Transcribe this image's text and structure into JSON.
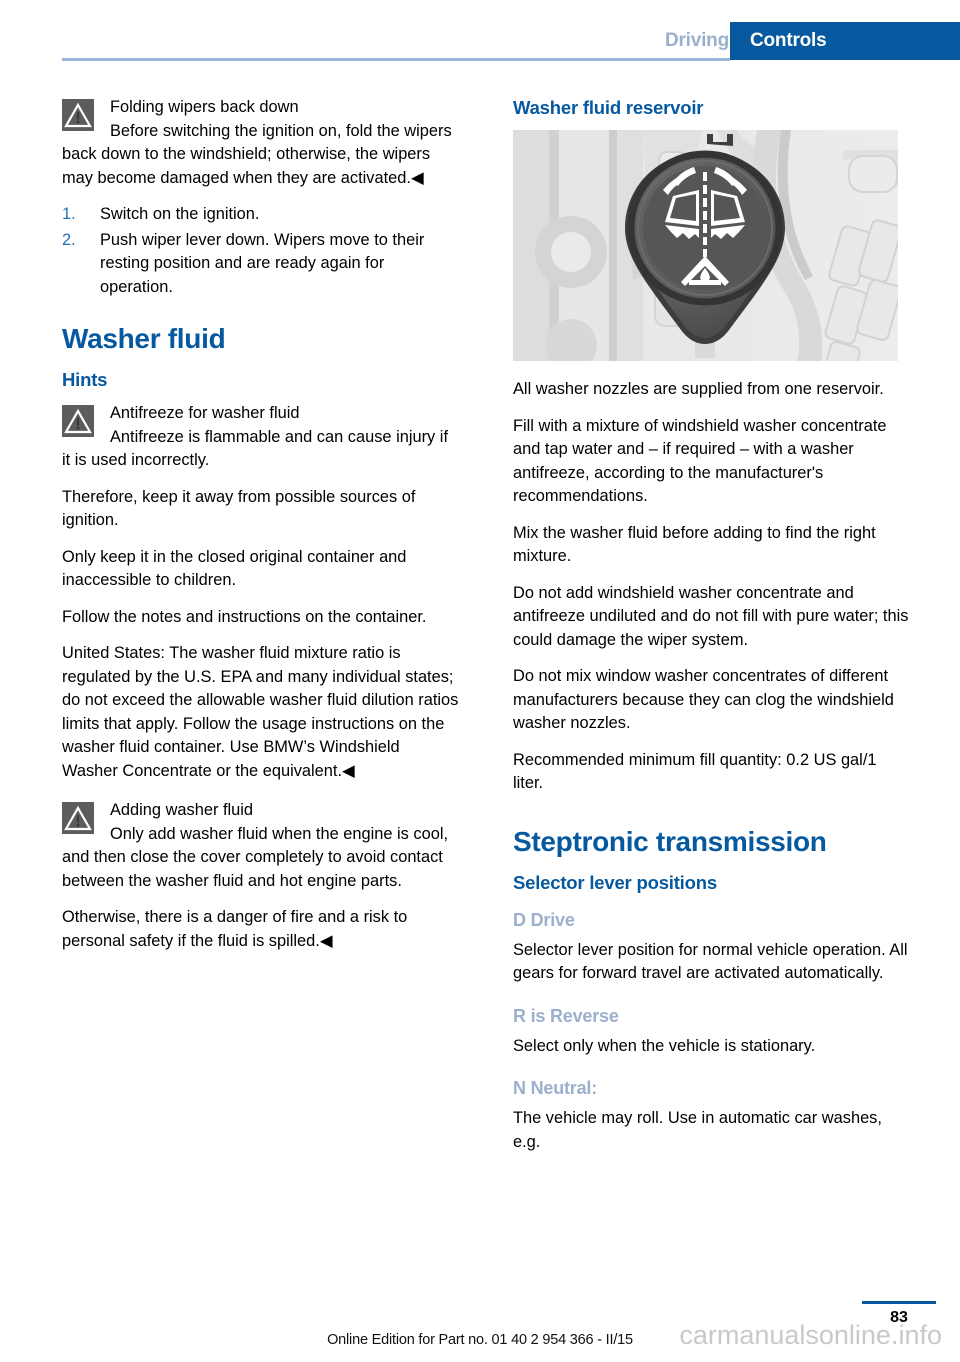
{
  "header": {
    "tab_inactive": "Driving",
    "tab_active": "Controls",
    "accent_color": "#06599f",
    "muted_color": "#9bb0cc"
  },
  "left_column": {
    "warning_1": {
      "icon": "warning-triangle-icon",
      "title": "Folding wipers back down",
      "body": "Before switching the ignition on, fold the wipers back down to the windshield; otherwise, the wipers may become damaged when they are activated.◀"
    },
    "steps": [
      {
        "number": "1.",
        "text": "Switch on the ignition."
      },
      {
        "number": "2.",
        "text": "Push wiper lever down. Wipers move to their resting position and are ready again for operation."
      }
    ],
    "chapter_title": "Washer fluid",
    "section_title": "Hints",
    "warning_2": {
      "icon": "warning-triangle-icon",
      "title": "Antifreeze for washer fluid",
      "body": "Antifreeze is flammable and can cause injury if it is used incorrectly."
    },
    "paragraphs": [
      "Therefore, keep it away from possible sources of ignition.",
      "Only keep it in the closed original container and inaccessible to children.",
      "Follow the notes and instructions on the container.",
      "United States: The washer fluid mixture ratio is regulated by the U.S. EPA and many individual states; do not exceed the allowable washer fluid dilution ratios limits that apply. Follow the usage instructions on the washer fluid container. Use BMW’s Windshield Washer Concentrate or the equivalent.◀"
    ],
    "warning_3": {
      "icon": "warning-triangle-icon",
      "title": "Adding washer fluid",
      "body": "Only add washer fluid when the engine is cool, and then close the cover completely to avoid contact between the washer fluid and hot engine parts."
    },
    "closing_paragraph": "Otherwise, there is a danger of fire and a risk to personal safety if the fluid is spilled.◀"
  },
  "right_column": {
    "section_title": "Washer fluid reservoir",
    "figure": {
      "name": "washer-fluid-reservoir-cap-illustration",
      "description": "Engine bay view with dark teardrop-shaped washer fluid reservoir cap bearing a white windshield washer symbol",
      "background_color": "#e8e9ea",
      "cap_color": "#575757"
    },
    "paragraphs": [
      "All washer nozzles are supplied from one reservoir.",
      "Fill with a mixture of windshield washer concentrate and tap water and – if required – with a washer antifreeze, according to the manufacturer's recommendations.",
      "Mix the washer fluid before adding to find the right mixture.",
      "Do not add windshield washer concentrate and antifreeze undiluted and do not fill with pure water; this could damage the wiper system.",
      "Do not mix window washer concentrates of different manufacturers because they can clog the windshield washer nozzles.",
      "Recommended minimum fill quantity: 0.2 US gal/1 liter."
    ],
    "chapter_title": "Steptronic transmission",
    "section_title_2": "Selector lever positions",
    "gear_positions": [
      {
        "heading": "D Drive",
        "text": "Selector lever position for normal vehicle operation. All gears for forward travel are activated automatically."
      },
      {
        "heading": "R is Reverse",
        "text": "Select only when the vehicle is stationary."
      },
      {
        "heading": "N Neutral:",
        "text": "The vehicle may roll. Use in automatic car washes, e.g."
      }
    ]
  },
  "footer": {
    "page_number": "83",
    "edition_note": "Online Edition for Part no. 01 40 2 954 366 - II/15",
    "watermark": "carmanualsonline.info"
  }
}
